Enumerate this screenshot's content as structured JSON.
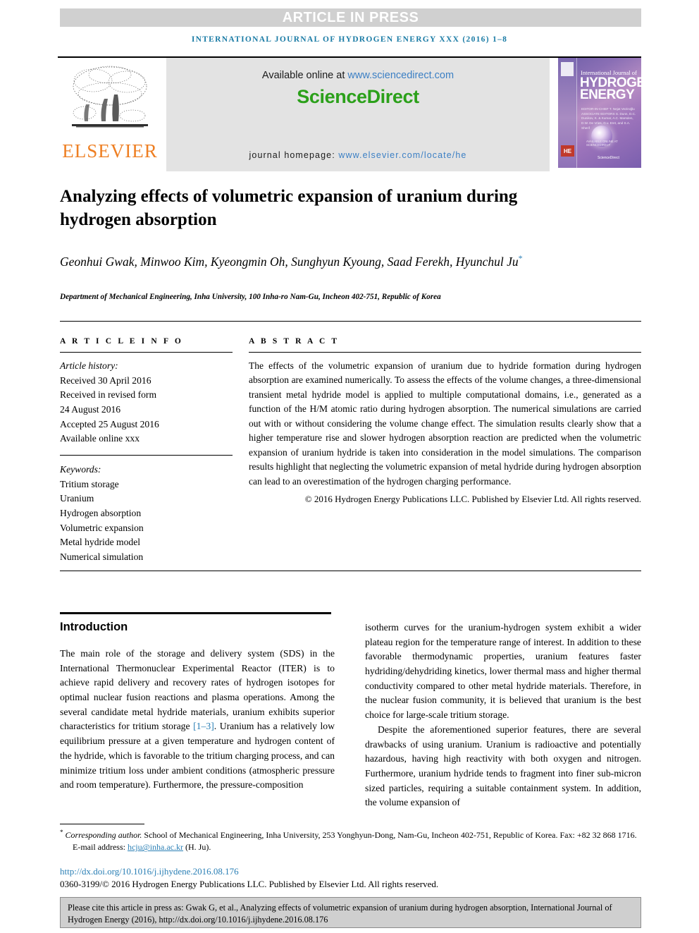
{
  "banner": {
    "label": "ARTICLE IN PRESS"
  },
  "running_head": {
    "text": "INTERNATIONAL JOURNAL OF HYDROGEN ENERGY XXX (2016) 1–8"
  },
  "masthead": {
    "publisher_logo_name": "ELSEVIER",
    "available_prefix": "Available online at ",
    "available_url": "www.sciencedirect.com",
    "sciencedirect_logo": "ScienceDirect",
    "homepage_prefix": "journal homepage: ",
    "homepage_url": "www.elsevier.com/locate/he",
    "cover": {
      "line1": "International Journal of",
      "line2": "HYDROGEN",
      "line3": "ENERGY",
      "editors": "EDITOR-IN-CHIEF   T. Nejat Veziroğlu\nASSOCIATE EDITORS   S. Dunn, D.C. Dunikov, K. & Kumar,\nA.C. Marsden, D.W. De Vries,\nG.v. Eret, and S.A. Sherif",
      "footnote": "AVAILABLE ONLINE AT SCIENCEDIRECT",
      "sciencedirect": "ScienceDirect",
      "badge": "HE"
    }
  },
  "article": {
    "title": "Analyzing effects of volumetric expansion of uranium during hydrogen absorption",
    "authors": "Geonhui Gwak, Minwoo Kim, Kyeongmin Oh, Sunghyun Kyoung, Saad Ferekh, Hyunchul Ju",
    "corresponding_marker": "*",
    "affiliation": "Department of Mechanical Engineering, Inha University, 100 Inha-ro Nam-Gu, Incheon 402-751, Republic of Korea"
  },
  "article_info": {
    "heading": "A R T I C L E   I N F O",
    "history_label": "Article history:",
    "history": [
      "Received 30 April 2016",
      "Received in revised form",
      "24 August 2016",
      "Accepted 25 August 2016",
      "Available online xxx"
    ],
    "keywords_label": "Keywords:",
    "keywords": [
      "Tritium storage",
      "Uranium",
      "Hydrogen absorption",
      "Volumetric expansion",
      "Metal hydride model",
      "Numerical simulation"
    ]
  },
  "abstract": {
    "heading": "A B S T R A C T",
    "body": "The effects of the volumetric expansion of uranium due to hydride formation during hydrogen absorption are examined numerically. To assess the effects of the volume changes, a three-dimensional transient metal hydride model is applied to multiple computational domains, i.e., generated as a function of the H/M atomic ratio during hydrogen absorption. The numerical simulations are carried out with or without considering the volume change effect. The simulation results clearly show that a higher temperature rise and slower hydrogen absorption reaction are predicted when the volumetric expansion of uranium hydride is taken into consideration in the model simulations. The comparison results highlight that neglecting the volumetric expansion of metal hydride during hydrogen absorption can lead to an overestimation of the hydrogen charging performance.",
    "copyright": "© 2016 Hydrogen Energy Publications LLC. Published by Elsevier Ltd. All rights reserved."
  },
  "introduction": {
    "heading": "Introduction",
    "left_paragraph": "The main role of the storage and delivery system (SDS) in the International Thermonuclear Experimental Reactor (ITER) is to achieve rapid delivery and recovery rates of hydrogen isotopes for optimal nuclear fusion reactions and plasma operations. Among the several candidate metal hydride materials, uranium exhibits superior characteristics for tritium storage ",
    "left_citation": "[1–3]",
    "left_paragraph_cont": ". Uranium has a relatively low equilibrium pressure at a given temperature and hydrogen content of the hydride, which is favorable to the tritium charging process, and can minimize tritium loss under ambient conditions (atmospheric pressure and room temperature). Furthermore, the pressure-composition",
    "right_paragraph_1": "isotherm curves for the uranium-hydrogen system exhibit a wider plateau region for the temperature range of interest. In addition to these favorable thermodynamic properties, uranium features faster hydriding/dehydriding kinetics, lower thermal mass and higher thermal conductivity compared to other metal hydride materials. Therefore, in the nuclear fusion community, it is believed that uranium is the best choice for large-scale tritium storage.",
    "right_paragraph_2": "Despite the aforementioned superior features, there are several drawbacks of using uranium. Uranium is radioactive and potentially hazardous, having high reactivity with both oxygen and nitrogen. Furthermore, uranium hydride tends to fragment into finer sub-micron sized particles, requiring a suitable containment system. In addition, the volume expansion of"
  },
  "footer": {
    "corresponding_label": "Corresponding author.",
    "corresponding_text": " School of Mechanical Engineering, Inha University, 253 Yonghyun-Dong, Nam-Gu, Incheon 402-751, Republic of Korea. Fax: +82 32 868 1716.",
    "email_label": "E-mail address: ",
    "email": "hcju@inha.ac.kr",
    "email_suffix": " (H. Ju).",
    "doi": "http://dx.doi.org/10.1016/j.ijhydene.2016.08.176",
    "issn": "0360-3199/© 2016 Hydrogen Energy Publications LLC. Published by Elsevier Ltd. All rights reserved."
  },
  "citation_box": {
    "text": "Please cite this article in press as: Gwak G, et al., Analyzing effects of volumetric expansion of uranium during hydrogen absorption, International Journal of Hydrogen Energy (2016), http://dx.doi.org/10.1016/j.ijhydene.2016.08.176"
  }
}
